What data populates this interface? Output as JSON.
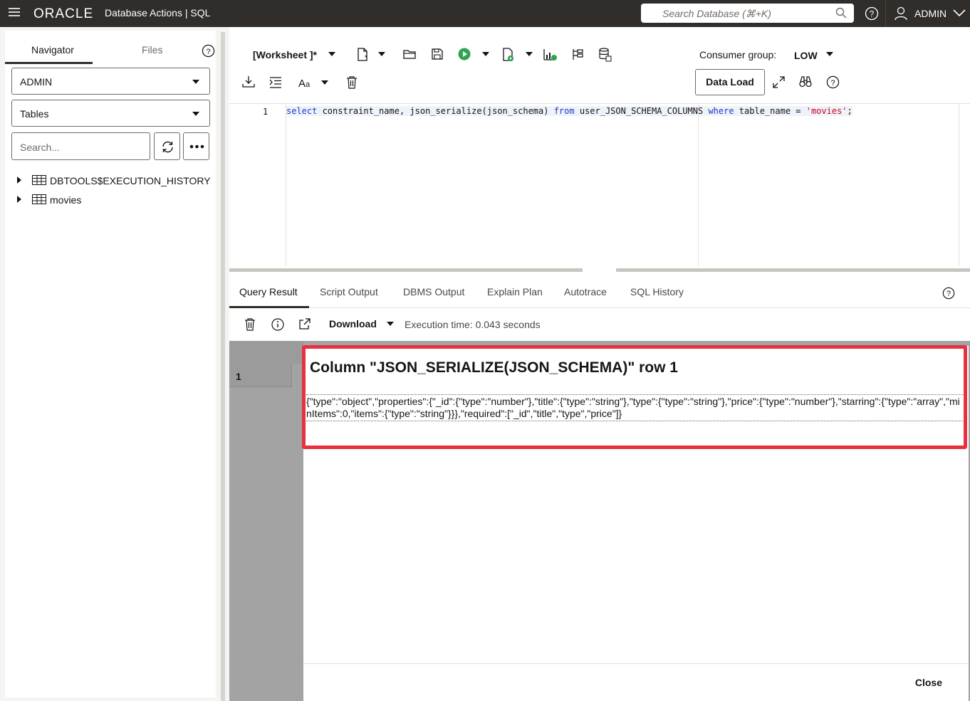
{
  "header": {
    "logo": "ORACLE",
    "app_title": "Database Actions | SQL",
    "search_placeholder": "Search Database (⌘+K)",
    "user": "ADMIN"
  },
  "navigator": {
    "tabs": [
      "Navigator",
      "Files"
    ],
    "schema": "ADMIN",
    "object_type": "Tables",
    "search_placeholder": "Search...",
    "items": [
      {
        "label": "DBTOOLS$EXECUTION_HISTORY"
      },
      {
        "label": "movies"
      }
    ]
  },
  "toolbar": {
    "worksheet_name": "[Worksheet ]*",
    "consumer_group_label": "Consumer group:",
    "consumer_group_value": "LOW",
    "data_load_label": "Data Load"
  },
  "editor": {
    "line_number": "1",
    "tokens": {
      "select": "select",
      "cols": " constraint_name, json_serialize(json_schema) ",
      "from": "from",
      "table": " user_JSON_SCHEMA_COLUMNS ",
      "where": "where",
      "cond": " table_name = ",
      "value": "'movies'",
      "end": ";"
    }
  },
  "results": {
    "tabs": [
      "Query Result",
      "Script Output",
      "DBMS Output",
      "Explain Plan",
      "Autotrace",
      "SQL History"
    ],
    "download_label": "Download",
    "execution_time": "Execution time: 0.043 seconds",
    "row_number": "1"
  },
  "dialog": {
    "title": "Column \"JSON_SERIALIZE(JSON_SCHEMA)\" row 1",
    "content": "{\"type\":\"object\",\"properties\":{\"_id\":{\"type\":\"number\"},\"title\":{\"type\":\"string\"},\"type\":{\"type\":\"string\"},\"price\":{\"type\":\"number\"},\"starring\":{\"type\":\"array\",\"minItems\":0,\"items\":{\"type\":\"string\"}}},\"required\":[\"_id\",\"title\",\"type\",\"price\"]}",
    "close_label": "Close"
  },
  "colors": {
    "topbar": "#312d2a",
    "highlight": "#e8303f",
    "run_green": "#2ea44f",
    "keyword": "#1d3bc9",
    "string": "#d0021b"
  }
}
